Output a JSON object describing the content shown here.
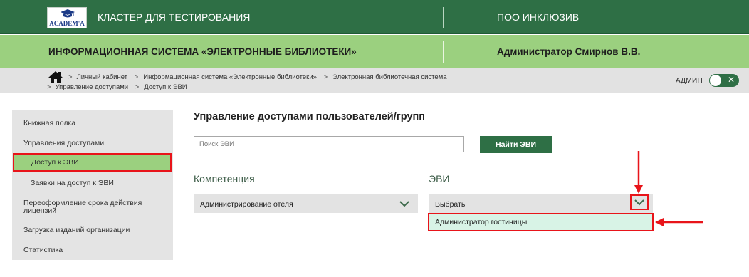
{
  "header": {
    "logo_text": "ACADEM'A",
    "cluster_title": "КЛАСТЕР ДЛЯ ТЕСТИРОВАНИЯ",
    "org": "ПОО ИНКЛЮЗИВ"
  },
  "subheader": {
    "system_title": "ИНФОРМАЦИОННАЯ СИСТЕМА «ЭЛЕКТРОННЫЕ БИБЛИОТЕКИ»",
    "user": "Администратор Смирнов В.В."
  },
  "breadcrumb": {
    "items": [
      "Личный кабинет",
      "Информационная система «Электронные библиотеки»",
      "Электронная библиотечная система",
      "Управление доступами",
      "Доступ к ЭВИ"
    ],
    "separator": ">"
  },
  "admin_toggle": {
    "label": "АДМИН",
    "state": "on",
    "icon": "close-x-icon"
  },
  "sidebar": {
    "items": [
      {
        "label": "Книжная полка"
      },
      {
        "label": "Управления доступами"
      },
      {
        "label": "Доступ к ЭВИ",
        "active": true
      },
      {
        "label": "Заявки на доступ к ЭВИ"
      },
      {
        "label_line1": "Переоформление срока действия",
        "label_line2": "лицензий"
      },
      {
        "label": "Загрузка изданий организации"
      },
      {
        "label": "Статистика"
      }
    ]
  },
  "main": {
    "title": "Управление доступами пользователей/групп",
    "search": {
      "placeholder": "Поиск ЭВИ",
      "value": ""
    },
    "find_button": "Найти ЭВИ",
    "competence": {
      "label": "Компетенция",
      "selected": "Администрирование отеля"
    },
    "evi": {
      "label": "ЭВИ",
      "selected": "Выбрать",
      "options": [
        "Администратор гостиницы"
      ]
    }
  },
  "colors": {
    "header_green": "#2e6f45",
    "subheader_green": "#9bd07f",
    "highlight_red": "#e8141a",
    "dropdown_bg": "#d8f3e6"
  }
}
